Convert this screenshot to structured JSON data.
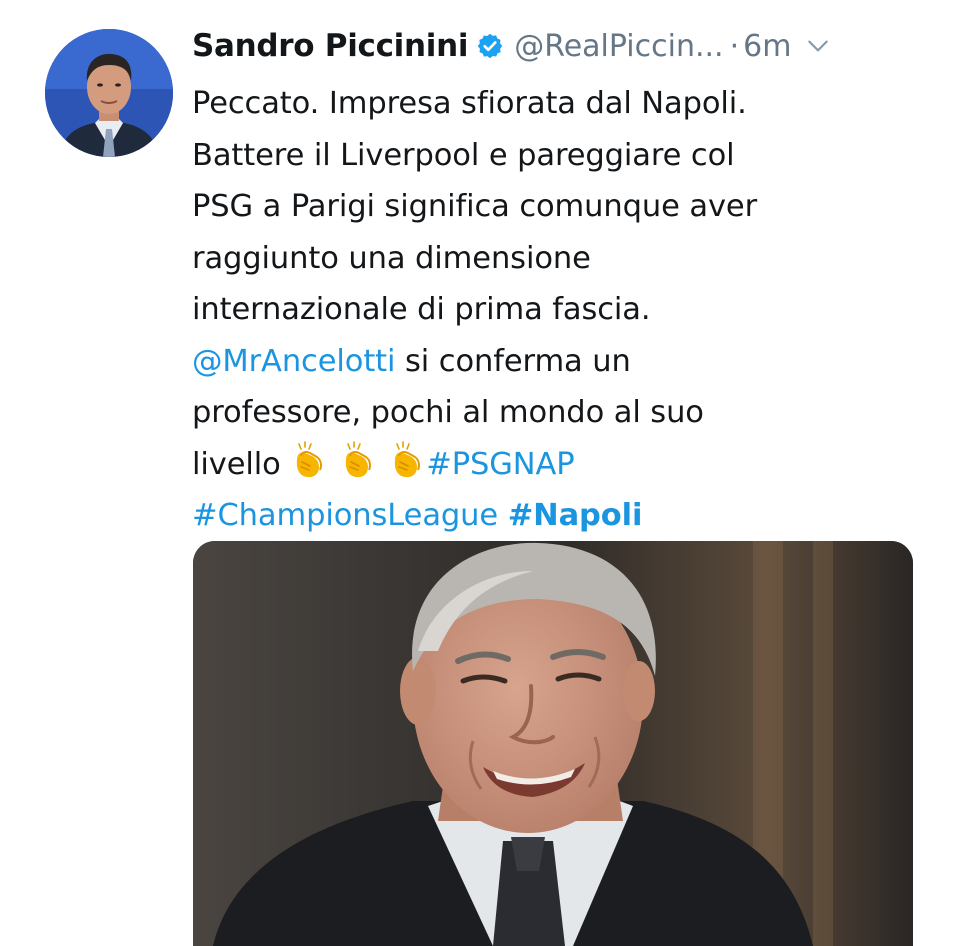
{
  "tweet": {
    "display_name": "Sandro Piccinini",
    "handle": "@RealPiccin...",
    "separator": "·",
    "time": "6m",
    "lines": {
      "l1": "Peccato. Impresa sfiorata dal Napoli.",
      "l2": "Battere il Liverpool e pareggiare col",
      "l3": "PSG a Parigi significa comunque aver",
      "l4": "raggiunto una dimensione",
      "l5": "internazionale di prima fascia.",
      "l6_mention": "@MrAncelotti",
      "l6_rest": " si conferma un",
      "l7": "professore, pochi al mondo al suo",
      "l8_text": "livello ",
      "l8_hashtag": "#PSGNAP",
      "l9_hashtag1": "#ChampionsLeague",
      "l9_space": " ",
      "l9_hashtag2": "#Napoli"
    },
    "icons": {
      "verified": "verified-badge-icon",
      "menu": "chevron-down-icon",
      "emoji": "clapping-hands-emoji"
    },
    "colors": {
      "link": "#1b95e0",
      "muted": "#657786",
      "text": "#14171a"
    }
  }
}
